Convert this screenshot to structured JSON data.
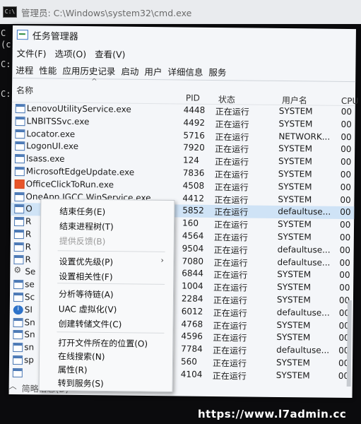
{
  "cmd": {
    "title": "管理员: C:\\Windows\\system32\\cmd.exe",
    "icon": "cmd-prompt-icon",
    "lines": [
      "C",
      "(c)",
      "C:",
      "C:"
    ]
  },
  "taskmgr": {
    "title": "任务管理器",
    "menu": [
      "文件(F)",
      "选项(O)",
      "查看(V)"
    ],
    "tabs": [
      "进程",
      "性能",
      "应用历史记录",
      "启动",
      "用户",
      "详细信息",
      "服务"
    ],
    "columns": {
      "name": "名称",
      "pid": "PID",
      "status": "状态",
      "user": "用户名",
      "cpu": "CPU"
    },
    "rows": [
      {
        "name": "LenovoUtilityService.exe",
        "pid": "4448",
        "status": "正在运行",
        "user": "SYSTEM",
        "cpu": "00",
        "icon": "window"
      },
      {
        "name": "LNBITSSvc.exe",
        "pid": "4492",
        "status": "正在运行",
        "user": "SYSTEM",
        "cpu": "00",
        "icon": "window"
      },
      {
        "name": "Locator.exe",
        "pid": "5716",
        "status": "正在运行",
        "user": "NETWORK...",
        "cpu": "00",
        "icon": "window"
      },
      {
        "name": "LogonUI.exe",
        "pid": "7920",
        "status": "正在运行",
        "user": "SYSTEM",
        "cpu": "00",
        "icon": "window"
      },
      {
        "name": "lsass.exe",
        "pid": "124",
        "status": "正在运行",
        "user": "SYSTEM",
        "cpu": "00",
        "icon": "window"
      },
      {
        "name": "MicrosoftEdgeUpdate.exe",
        "pid": "7836",
        "status": "正在运行",
        "user": "SYSTEM",
        "cpu": "00",
        "icon": "window"
      },
      {
        "name": "OfficeClickToRun.exe",
        "pid": "4508",
        "status": "正在运行",
        "user": "SYSTEM",
        "cpu": "00",
        "icon": "orange"
      },
      {
        "name": "OneApp.IGCC.WinService.exe",
        "pid": "4412",
        "status": "正在运行",
        "user": "SYSTEM",
        "cpu": "00",
        "icon": "window"
      },
      {
        "name": "O",
        "pid": "5852",
        "status": "正在运行",
        "user": "defaultuse...",
        "cpu": "00",
        "icon": "window"
      },
      {
        "name": "R",
        "pid": "160",
        "status": "正在运行",
        "user": "SYSTEM",
        "cpu": "00",
        "icon": "window"
      },
      {
        "name": "R",
        "pid": "4564",
        "status": "正在运行",
        "user": "SYSTEM",
        "cpu": "00",
        "icon": "window"
      },
      {
        "name": "R",
        "pid": "9504",
        "status": "正在运行",
        "user": "defaultuse...",
        "cpu": "00",
        "icon": "window"
      },
      {
        "name": "R",
        "pid": "7080",
        "status": "正在运行",
        "user": "defaultuse...",
        "cpu": "00",
        "icon": "window"
      },
      {
        "name": "Se",
        "pid": "6844",
        "status": "正在运行",
        "user": "SYSTEM",
        "cpu": "00",
        "icon": "gear"
      },
      {
        "name": "se",
        "pid": "1004",
        "status": "正在运行",
        "user": "SYSTEM",
        "cpu": "00",
        "icon": "window"
      },
      {
        "name": "Sc",
        "pid": "2284",
        "status": "正在运行",
        "user": "SYSTEM",
        "cpu": "00",
        "icon": "window"
      },
      {
        "name": "SI",
        "pid": "6012",
        "status": "正在运行",
        "user": "defaultuse...",
        "cpu": "00",
        "icon": "info"
      },
      {
        "name": "Sn",
        "pid": "4768",
        "status": "正在运行",
        "user": "SYSTEM",
        "cpu": "00",
        "icon": "window"
      },
      {
        "name": "Sn",
        "pid": "4596",
        "status": "正在运行",
        "user": "SYSTEM",
        "cpu": "00",
        "icon": "window"
      },
      {
        "name": "sn",
        "pid": "7784",
        "status": "正在运行",
        "user": "defaultuse...",
        "cpu": "00",
        "icon": "window"
      },
      {
        "name": "sp",
        "pid": "560",
        "status": "正在运行",
        "user": "SYSTEM",
        "cpu": "00",
        "icon": "window"
      },
      {
        "name": "",
        "pid": "4104",
        "status": "正在运行",
        "user": "SYSTEM",
        "cpu": "00",
        "icon": "window"
      }
    ],
    "selected_row": 8,
    "footer": "简略信息(D)"
  },
  "context_menu": {
    "items": [
      {
        "label": "结束任务(E)",
        "enabled": true
      },
      {
        "label": "结束进程树(T)",
        "enabled": true
      },
      {
        "label": "提供反馈(B)",
        "enabled": false
      },
      {
        "label": "设置优先级(P)",
        "enabled": true,
        "submenu": true
      },
      {
        "label": "设置相关性(F)",
        "enabled": true
      },
      {
        "label": "分析等待链(A)",
        "enabled": true
      },
      {
        "label": "UAC 虚拟化(V)",
        "enabled": true
      },
      {
        "label": "创建转储文件(C)",
        "enabled": true
      },
      {
        "label": "打开文件所在的位置(O)",
        "enabled": true
      },
      {
        "label": "在线搜索(N)",
        "enabled": true
      },
      {
        "label": "属性(R)",
        "enabled": true
      },
      {
        "label": "转到服务(S)",
        "enabled": true
      }
    ],
    "submenu_arrow": "›"
  },
  "watermark": "https://www.l7admin.cc",
  "colors": {
    "selection": "#cfe3f6",
    "background": "#f4f6f9",
    "cmd_background": "#0b0b0d"
  }
}
